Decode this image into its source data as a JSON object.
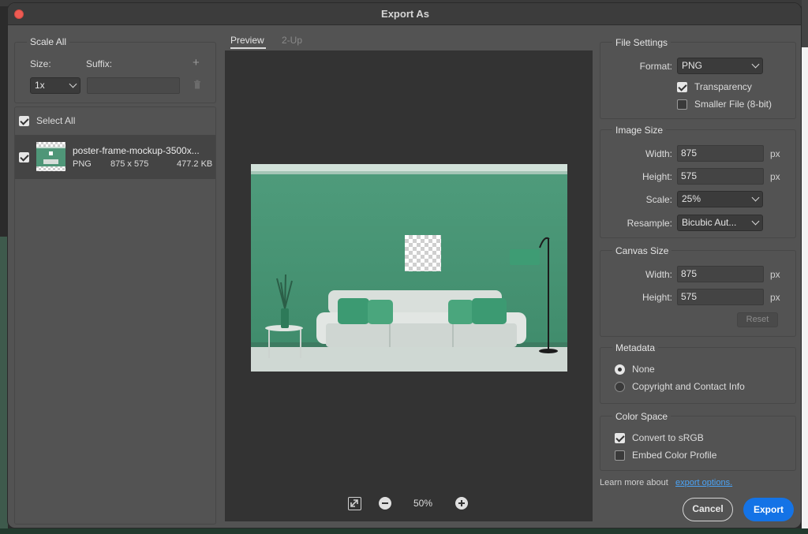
{
  "window": {
    "title": "Export As"
  },
  "scale_all": {
    "title": "Scale All",
    "size_label": "Size:",
    "suffix_label": "Suffix:",
    "size_value": "1x",
    "suffix_value": "",
    "add_symbol": "+",
    "delete_icon": "trash-icon"
  },
  "assets": {
    "select_all_label": "Select All",
    "items": [
      {
        "name": "poster-frame-mockup-3500x...",
        "format": "PNG",
        "dimensions": "875 x 575",
        "size": "477.2 KB",
        "checked": true
      }
    ]
  },
  "tabs": [
    {
      "label": "Preview",
      "active": true
    },
    {
      "label": "2-Up",
      "active": false
    }
  ],
  "preview_controls": {
    "zoom": "50%",
    "fit_icon": "fit-screen-icon",
    "zoom_out_icon": "minus-circle-icon",
    "zoom_in_icon": "plus-circle-icon"
  },
  "file_settings": {
    "title": "File Settings",
    "format_label": "Format:",
    "format_value": "PNG",
    "transparency_label": "Transparency",
    "transparency_checked": true,
    "smaller_file_label": "Smaller File (8-bit)",
    "smaller_file_checked": false
  },
  "image_size": {
    "title": "Image Size",
    "width_label": "Width:",
    "width_value": "875",
    "height_label": "Height:",
    "height_value": "575",
    "unit": "px",
    "scale_label": "Scale:",
    "scale_value": "25%",
    "resample_label": "Resample:",
    "resample_value": "Bicubic Aut..."
  },
  "canvas_size": {
    "title": "Canvas Size",
    "width_label": "Width:",
    "width_value": "875",
    "height_label": "Height:",
    "height_value": "575",
    "unit": "px",
    "reset_label": "Reset"
  },
  "metadata": {
    "title": "Metadata",
    "options": [
      {
        "label": "None",
        "selected": true
      },
      {
        "label": "Copyright and Contact Info",
        "selected": false
      }
    ]
  },
  "color_space": {
    "title": "Color Space",
    "convert_label": "Convert to sRGB",
    "convert_checked": true,
    "embed_label": "Embed Color Profile",
    "embed_checked": false
  },
  "footer": {
    "learn_more": "Learn more about",
    "link_text": "export options.",
    "cancel_label": "Cancel",
    "export_label": "Export"
  },
  "colors": {
    "accent": "#1473e6",
    "link": "#4ba3f5",
    "wall": "#4f9678",
    "panel_bg": "#535353"
  }
}
